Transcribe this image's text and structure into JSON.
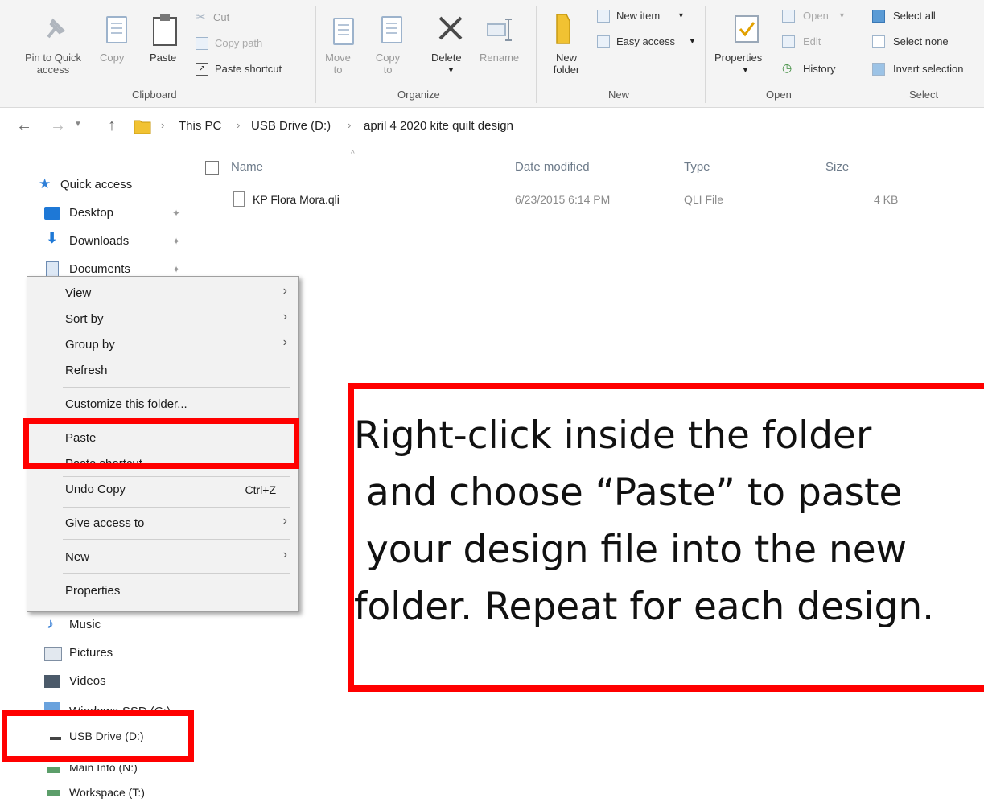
{
  "ribbon": {
    "clipboard": {
      "group_label": "Clipboard",
      "pin": "Pin to Quick\naccess",
      "copy": "Copy",
      "paste": "Paste",
      "cut": "Cut",
      "copy_path": "Copy path",
      "paste_shortcut": "Paste shortcut"
    },
    "organize": {
      "group_label": "Organize",
      "move_to": "Move\nto",
      "copy_to": "Copy\nto",
      "delete": "Delete",
      "rename": "Rename"
    },
    "new": {
      "group_label": "New",
      "new_folder": "New\nfolder",
      "new_item": "New item",
      "easy_access": "Easy access"
    },
    "open": {
      "group_label": "Open",
      "properties": "Properties",
      "open": "Open",
      "edit": "Edit",
      "history": "History"
    },
    "select": {
      "group_label": "Select",
      "select_all": "Select all",
      "select_none": "Select none",
      "invert": "Invert selection"
    }
  },
  "breadcrumb": [
    "This PC",
    "USB Drive (D:)",
    "april 4 2020 kite quilt design"
  ],
  "columns": {
    "name": "Name",
    "date": "Date modified",
    "type": "Type",
    "size": "Size"
  },
  "files": [
    {
      "name": "KP Flora Mora.qli",
      "date": "6/23/2015 6:14 PM",
      "type": "QLI File",
      "size": "4 KB"
    }
  ],
  "sidebar": {
    "quick_access": "Quick access",
    "desktop": "Desktop",
    "downloads": "Downloads",
    "documents": "Documents",
    "music": "Music",
    "pictures": "Pictures",
    "videos": "Videos",
    "windows_ssd": "Windows-SSD (C:)",
    "usb": "USB Drive (D:)",
    "main_info": "Main Info (N:)",
    "workspace": "Workspace (T:)"
  },
  "context_menu": {
    "view": "View",
    "sort_by": "Sort by",
    "group_by": "Group by",
    "refresh": "Refresh",
    "customize": "Customize this folder...",
    "paste": "Paste",
    "paste_shortcut": "Paste shortcut",
    "undo_copy": "Undo Copy",
    "undo_shortcut": "Ctrl+Z",
    "give_access": "Give access to",
    "new": "New",
    "properties": "Properties"
  },
  "callout": {
    "text": "Right-click inside the folder\n and choose “Paste” to paste\n your design file into the new\nfolder. Repeat for each design."
  },
  "colors": {
    "highlight": "#ff0000",
    "folder": "#e8b800",
    "accent": "#1e6fd0"
  }
}
